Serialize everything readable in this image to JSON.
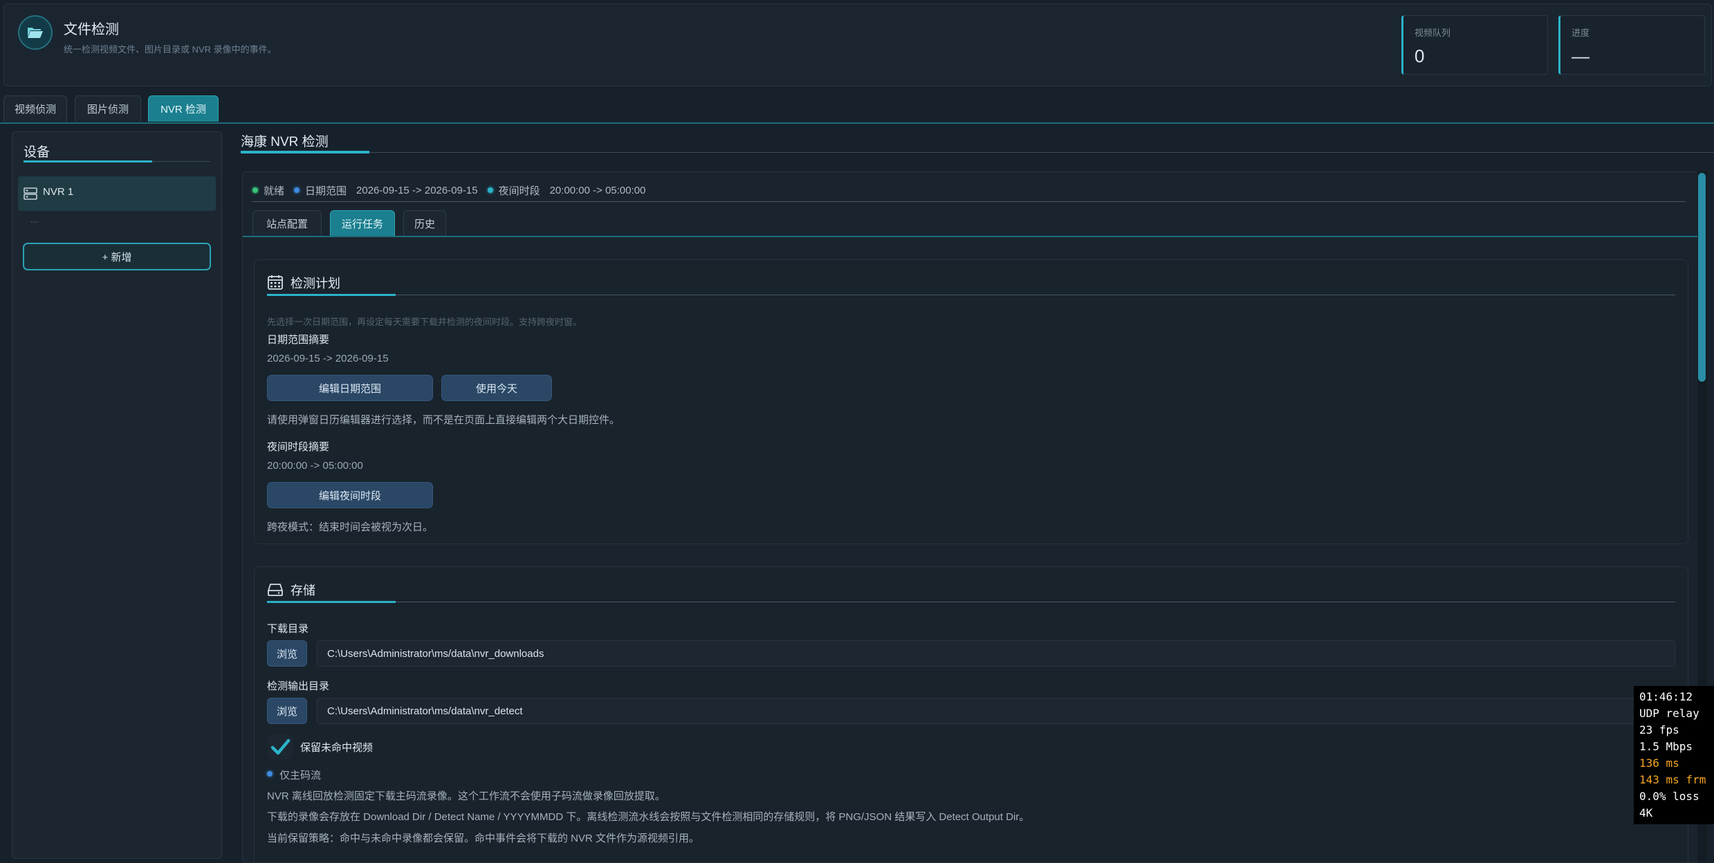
{
  "header": {
    "title": "文件检测",
    "subtitle": "统一检测视频文件、图片目录或 NVR 录像中的事件。",
    "icon": "folder-icon",
    "stats": [
      {
        "label": "视频队列",
        "value": "0"
      },
      {
        "label": "进度",
        "value": "—"
      }
    ]
  },
  "tabs": [
    {
      "label": "视频侦测"
    },
    {
      "label": "图片侦测"
    },
    {
      "label": "NVR 检测",
      "active": true
    }
  ],
  "sidebar": {
    "title": "设备",
    "items": [
      {
        "label": "NVR 1",
        "icon": "server-icon"
      }
    ],
    "ellipsis": "...",
    "add_button": "+ 新增"
  },
  "main": {
    "title": "海康 NVR 检测",
    "status": {
      "state": "就绪",
      "date_label": "日期范围",
      "date_value": "2026-09-15 -> 2026-09-15",
      "night_label": "夜间时段",
      "night_value": "20:00:00 -> 05:00:00"
    },
    "subtabs": [
      {
        "label": "站点配置"
      },
      {
        "label": "运行任务",
        "active": true
      },
      {
        "label": "历史"
      }
    ],
    "plan": {
      "title": "检测计划",
      "icon": "calendar-icon",
      "hint": "先选择一次日期范围，再设定每天需要下载并检测的夜间时段。支持跨夜时窗。",
      "date_summary_label": "日期范围摘要",
      "date_summary_value": "2026-09-15 -> 2026-09-15",
      "edit_date_button": "编辑日期范围",
      "use_today_button": "使用今天",
      "date_note": "请使用弹窗日历编辑器进行选择，而不是在页面上直接编辑两个大日期控件。",
      "night_summary_label": "夜间时段摘要",
      "night_summary_value": "20:00:00 -> 05:00:00",
      "edit_night_button": "编辑夜间时段",
      "cross_note": "跨夜模式：结束时间会被视为次日。"
    },
    "storage": {
      "title": "存储",
      "icon": "drive-icon",
      "download_label": "下载目录",
      "browse_label": "浏览",
      "download_path": "C:\\Users\\Administrator\\ms/data\\nvr_downloads",
      "detect_label": "检测输出目录",
      "detect_path": "C:\\Users\\Administrator\\ms/data\\nvr_detect",
      "keep_label": "保留未命中视频",
      "keep_checked": true,
      "main_stream_label": "仅主码流",
      "note1": "NVR 离线回放检测固定下载主码流录像。这个工作流不会使用子码流做录像回放提取。",
      "note2": "下载的录像会存放在 Download Dir / Detect Name / YYYYMMDD 下。离线检测流水线会按照与文件检测相同的存储规则，将 PNG/JSON 结果写入 Detect Output Dir。",
      "note3": "当前保留策略：命中与未命中录像都会保留。命中事件会将下载的 NVR 文件作为源视频引用。"
    }
  },
  "overlay": {
    "lines": [
      {
        "text": "01:46:12",
        "color": "#ffffff"
      },
      {
        "text": "UDP relay",
        "color": "#ffffff"
      },
      {
        "text": "23 fps",
        "color": "#ffffff"
      },
      {
        "text": "1.5 Mbps",
        "color": "#ffffff"
      },
      {
        "text": "136 ms",
        "color": "#f5a623"
      },
      {
        "text": "143 ms frm",
        "color": "#f5a623"
      },
      {
        "text": "0.0% loss",
        "color": "#ffffff"
      },
      {
        "text": "4K",
        "color": "#ffffff"
      }
    ]
  },
  "colors": {
    "accent": "#2bb3c9",
    "ok": "#37c47a",
    "info": "#3c8be0",
    "warn": "#f5a623"
  }
}
